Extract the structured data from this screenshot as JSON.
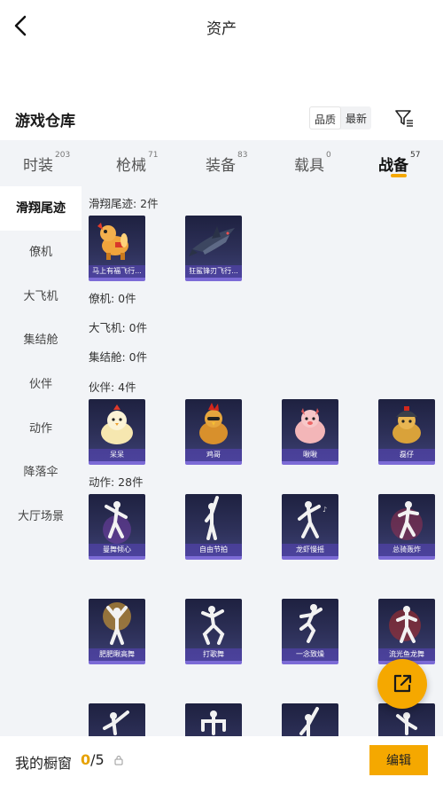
{
  "header": {
    "title": "资产"
  },
  "warehouse": {
    "title": "游戏仓库",
    "sort_quality": "品质",
    "sort_newest": "最新"
  },
  "categories": [
    {
      "label": "时装",
      "count": "203"
    },
    {
      "label": "枪械",
      "count": "71"
    },
    {
      "label": "装备",
      "count": "83"
    },
    {
      "label": "载具",
      "count": "0"
    },
    {
      "label": "战备",
      "count": "57"
    }
  ],
  "sidebar": [
    {
      "label": "滑翔尾迹"
    },
    {
      "label": "僚机"
    },
    {
      "label": "大飞机"
    },
    {
      "label": "集结舱"
    },
    {
      "label": "伙伴"
    },
    {
      "label": "动作"
    },
    {
      "label": "降落伞"
    },
    {
      "label": "大厅场景"
    }
  ],
  "sections": {
    "glide_trail": {
      "label": "滑翔尾迹: 2件",
      "items": [
        "马上有福飞行...",
        "狂鲨锋刃飞行..."
      ]
    },
    "wingman": {
      "label": "僚机: 0件"
    },
    "big_plane": {
      "label": "大飞机: 0件"
    },
    "assembly_pod": {
      "label": "集结舱: 0件"
    },
    "partner": {
      "label": "伙伴: 4件",
      "items": [
        "呆呆",
        "鸡哥",
        "啾啾",
        "磊仔"
      ]
    },
    "action": {
      "label": "动作: 28件",
      "items": [
        "曼舞倾心",
        "自由节拍",
        "龙虾慢摇",
        "总骑轰炸",
        "肥肥瞅高舞",
        "打歌舞",
        "一念致燥",
        "流光鱼龙舞"
      ]
    }
  },
  "showcase": {
    "label": "我的橱窗",
    "current": "0",
    "total": "/5",
    "edit_label": "编辑"
  },
  "colors": {
    "accent": "#f5a800",
    "card_bg": "#2d3058",
    "card_border": "#7c6bd6"
  },
  "icons": [
    "back-arrow-icon",
    "filter-icon",
    "share-out-icon",
    "lock-icon"
  ]
}
